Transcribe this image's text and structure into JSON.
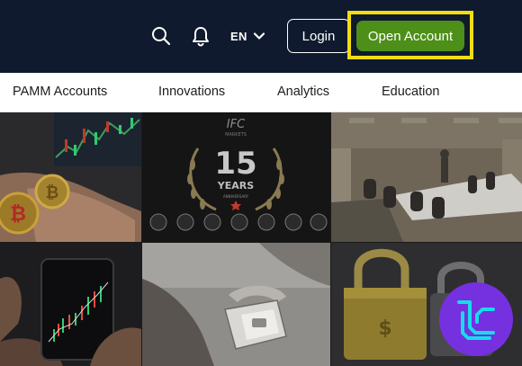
{
  "header": {
    "language": "EN",
    "login_label": "Login",
    "open_account_label": "Open Account",
    "accent_color": "#4d8f18",
    "highlight_color": "#f2dd13",
    "background_color": "#0f1a2e"
  },
  "nav": {
    "items": [
      "PAMM Accounts",
      "Innovations",
      "Analytics",
      "Education"
    ]
  },
  "gallery": {
    "anniversary": {
      "logo_text": "IFC",
      "logo_subtext": "MARKETS",
      "number": "15",
      "years_label": "YEARS",
      "sub_label": "ANNIVERSARY"
    },
    "tiles": [
      "bitcoin-coins-photo",
      "anniversary-awards-photo",
      "conference-room-photo",
      "phone-trading-chart-photo",
      "ring-box-photo",
      "padlock-photo"
    ]
  },
  "badge": {
    "icon": "tc-logo-icon",
    "color": "#7530e0"
  }
}
